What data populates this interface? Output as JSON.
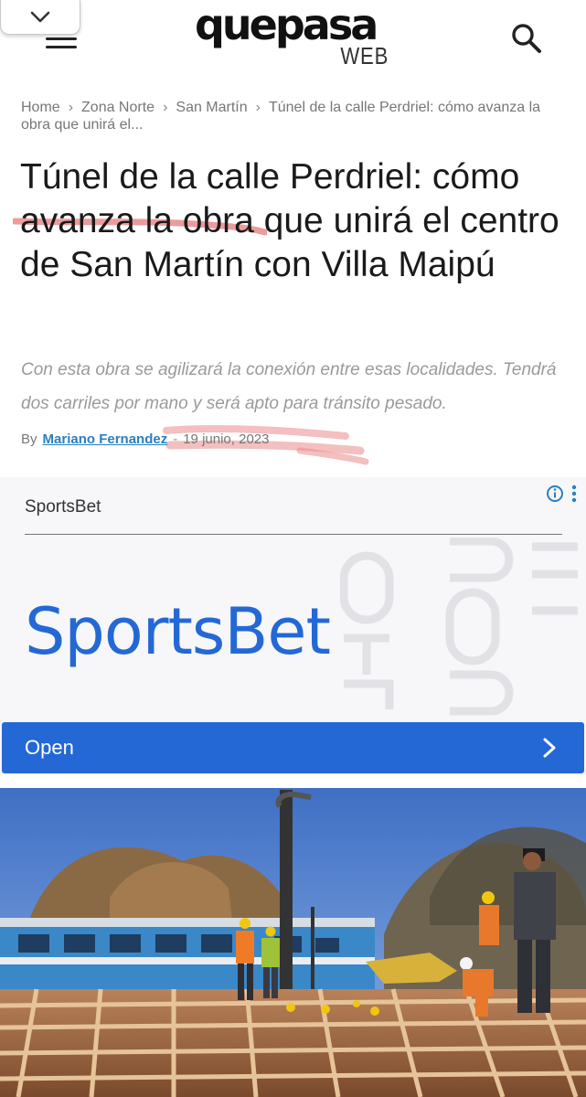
{
  "header": {
    "logo_main": "quepasa",
    "logo_sub": "WEB",
    "collapse_icon": "chevron-down-icon",
    "menu_icon": "hamburger-icon",
    "search_icon": "search-icon"
  },
  "breadcrumb": {
    "items": [
      "Home",
      "Zona Norte",
      "San Martín"
    ],
    "current": "Túnel de la calle Perdriel: cómo avanza la obra que unirá el..."
  },
  "article": {
    "title": "Túnel de la calle Perdriel: cómo avanza la obra que unirá el centro de San Martín con Villa Maipú",
    "subtitle": "Con esta obra se agilizará la conexión entre esas localidades. Tendrá dos carriles por mano y será apto para tránsito pesado.",
    "by": "By",
    "author": "Mariano Fernandez",
    "separator": "-",
    "date": "19 junio, 2023"
  },
  "ad": {
    "advertiser": "SportsBet",
    "headline": "SportsBet",
    "cta_label": "Open",
    "info_icon": "info-icon",
    "menu_icon": "more-vertical-icon",
    "cta_icon": "chevron-right-icon",
    "brand_color": "#2468d6"
  },
  "image": {
    "subject": "construction-site-photo"
  },
  "colors": {
    "link": "#2a7fc1",
    "highlight": "#e98a8a"
  }
}
